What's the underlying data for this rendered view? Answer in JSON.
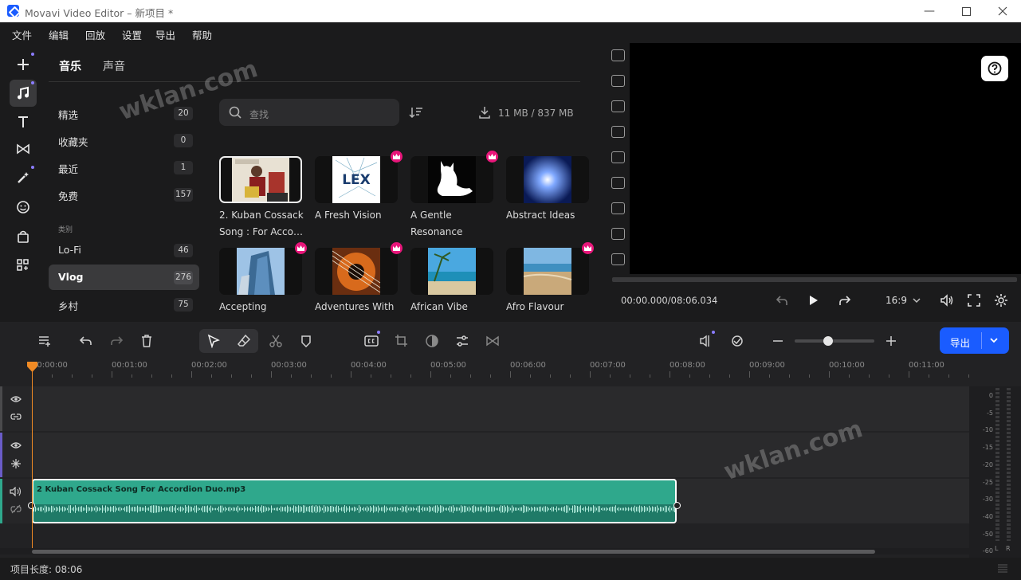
{
  "window": {
    "title": "Movavi Video Editor – 新项目 *"
  },
  "menu": [
    "文件",
    "编辑",
    "回放",
    "设置",
    "导出",
    "帮助"
  ],
  "library": {
    "tabs": [
      "音乐",
      "声音"
    ],
    "categories": [
      {
        "label": "精选",
        "count": "20"
      },
      {
        "label": "收藏夹",
        "count": "0"
      },
      {
        "label": "最近",
        "count": "1"
      },
      {
        "label": "免费",
        "count": "157"
      }
    ],
    "section_label": "类别",
    "genres": [
      {
        "label": "Lo-Fi",
        "count": "46"
      },
      {
        "label": "Vlog",
        "count": "276"
      },
      {
        "label": "乡村",
        "count": "75"
      }
    ],
    "search_placeholder": "查找",
    "storage": "11 MB / 837 MB",
    "items": [
      {
        "title": "2. Kuban Cossack Song : For Acco…",
        "premium": false,
        "selected": true
      },
      {
        "title": "A Fresh Vision",
        "premium": true,
        "selected": false,
        "thumb_text": "LEX"
      },
      {
        "title": "A Gentle Resonance",
        "premium": true,
        "selected": false
      },
      {
        "title": "Abstract Ideas",
        "premium": false,
        "selected": false
      },
      {
        "title": "Accepting",
        "premium": true,
        "selected": false
      },
      {
        "title": "Adventures With",
        "premium": true,
        "selected": false
      },
      {
        "title": "African Vibe",
        "premium": false,
        "selected": false
      },
      {
        "title": "Afro Flavour",
        "premium": true,
        "selected": false
      }
    ]
  },
  "preview": {
    "timecode": "00:00.000/08:06.034",
    "aspect": "16:9"
  },
  "timeline": {
    "export_label": "导出",
    "ruler": [
      "00:00:00",
      "00:01:00",
      "00:02:00",
      "00:03:00",
      "00:04:00",
      "00:05:00",
      "00:06:00",
      "00:07:00",
      "00:08:00",
      "00:09:00",
      "00:10:00",
      "00:11:00"
    ],
    "clip_name": "2 Kuban Cossack Song  For Accordion Duo.mp3",
    "meter_labels": [
      "0",
      "-5",
      "-10",
      "-15",
      "-20",
      "-25",
      "-30",
      "-40",
      "-50",
      "-60"
    ],
    "meter_lr": [
      "L",
      "R"
    ],
    "project_length": "项目长度: 08:06"
  },
  "watermark": "wklan.com",
  "colors": {
    "accent": "#1a5cff",
    "clip": "#2fa88c",
    "premium": "#e8167a",
    "playhead": "#f08a24"
  }
}
